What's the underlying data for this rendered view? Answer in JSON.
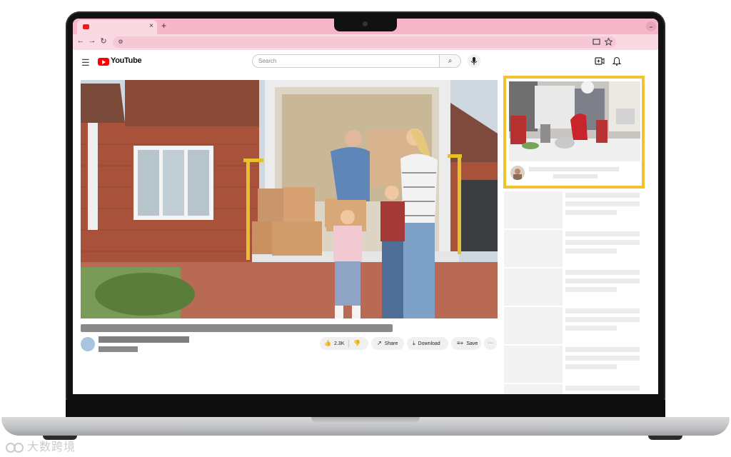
{
  "browser": {
    "tab_close_icon": "×",
    "new_tab_icon": "+",
    "tab_list_icon": "⌄",
    "back_icon": "←",
    "forward_icon": "→",
    "reload_icon": "↻",
    "site_info_icon": "⚙"
  },
  "youtube": {
    "menu_icon": "☰",
    "logo_text": "YouTube",
    "search_placeholder": "Search",
    "search_icon": "⌕",
    "mic_icon": "🎤",
    "create_icon": "⊕",
    "notifications_icon": "🔔"
  },
  "video_actions": {
    "like_count": "2.3K",
    "like_icon": "👍",
    "dislike_icon": "👎",
    "share_label": "Share",
    "share_icon": "↗",
    "download_label": "Download",
    "download_icon": "⤓",
    "save_label": "Save",
    "save_icon": "≡+",
    "more_icon": "···"
  },
  "watermark": "大数跨境",
  "colors": {
    "tab_strip": "#f5b6c8",
    "toolbar": "#fbd9e3",
    "ad_highlight": "#f2c12e",
    "youtube_red": "#ff0000"
  }
}
